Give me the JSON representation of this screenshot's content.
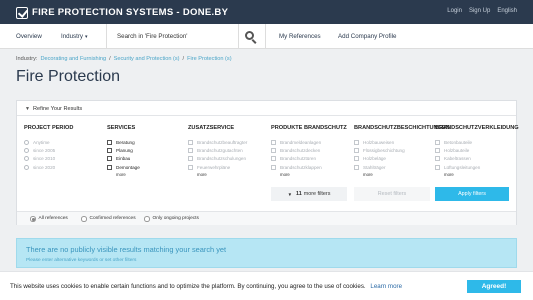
{
  "header": {
    "logo_text": "FIRE PROTECTION SYSTEMS - DONE.BY",
    "links": [
      "Login",
      "Sign Up",
      "English"
    ]
  },
  "nav": {
    "overview": "Overview",
    "industry": "Industry",
    "search_value": "Search in 'Fire Protection'",
    "my_references": "My References",
    "add_company": "Add Company Profile"
  },
  "breadcrumb": {
    "prefix": "Industry:",
    "items": [
      "Decorating and Furnishing",
      "Security and Protection (s)",
      "Fire Protection (s)"
    ],
    "separator": "/"
  },
  "page_title": "Fire Protection",
  "filters": {
    "toggle_label": "Refine Your Results",
    "columns": [
      {
        "title": "PROJECT PERIOD",
        "type": "radio",
        "options": [
          "Anytime",
          "since 2005",
          "since 2010",
          "since 2020"
        ],
        "more": ""
      },
      {
        "title": "SERVICES",
        "type": "check",
        "options": [
          "Beratung",
          "Planung",
          "Einbau",
          "Demontage"
        ],
        "more": "more"
      },
      {
        "title": "ZUSATZSERVICE",
        "type": "check",
        "options": [
          "Brandschutzbeauftragter",
          "Brandschutzgutachten",
          "Brandschutzschulungen",
          "Feuerwehrpläne"
        ],
        "more": "more"
      },
      {
        "title": "PRODUKTE BRANDSCHUTZ",
        "type": "check",
        "options": [
          "Brandmeldeanlagen",
          "Brandschutzdecken",
          "Brandschutztüren",
          "Brandschutzklappen"
        ],
        "more": "more"
      },
      {
        "title": "BRANDSCHUTZBESCHICHTUNGEN",
        "type": "check",
        "options": [
          "Holzbauweisen",
          "Flüssigbeschichtung",
          "Holzbeläge",
          "Stahlträger"
        ],
        "more": "more"
      },
      {
        "title": "BRANDSCHUTZVERKLEIDUNG",
        "type": "check",
        "options": [
          "Betonbauteile",
          "Holzbauteile",
          "Kabeltrassen",
          "Lüftungsleitungen"
        ],
        "more": "more"
      }
    ],
    "more_filters_count": "11",
    "more_filters_label": "more filters",
    "reset_label": "Reset filters",
    "apply_label": "Apply filters",
    "reference_options": [
      "All references",
      "Confirmed references",
      "Only ongoing projects"
    ]
  },
  "notice": {
    "title": "There are no publicly visible results matching your search yet",
    "subtitle": "Please enter alternative keywords or set other filters"
  },
  "cookie": {
    "text": "This website uses cookies to enable certain functions and to optimize the platform. By continuing, you agree to the use of cookies.",
    "link": "Learn more",
    "button": "Agreed!"
  },
  "colors": {
    "topbar": "#2b3a4e",
    "accent": "#2eb9e9",
    "notice_bg": "#b6e6f4"
  }
}
